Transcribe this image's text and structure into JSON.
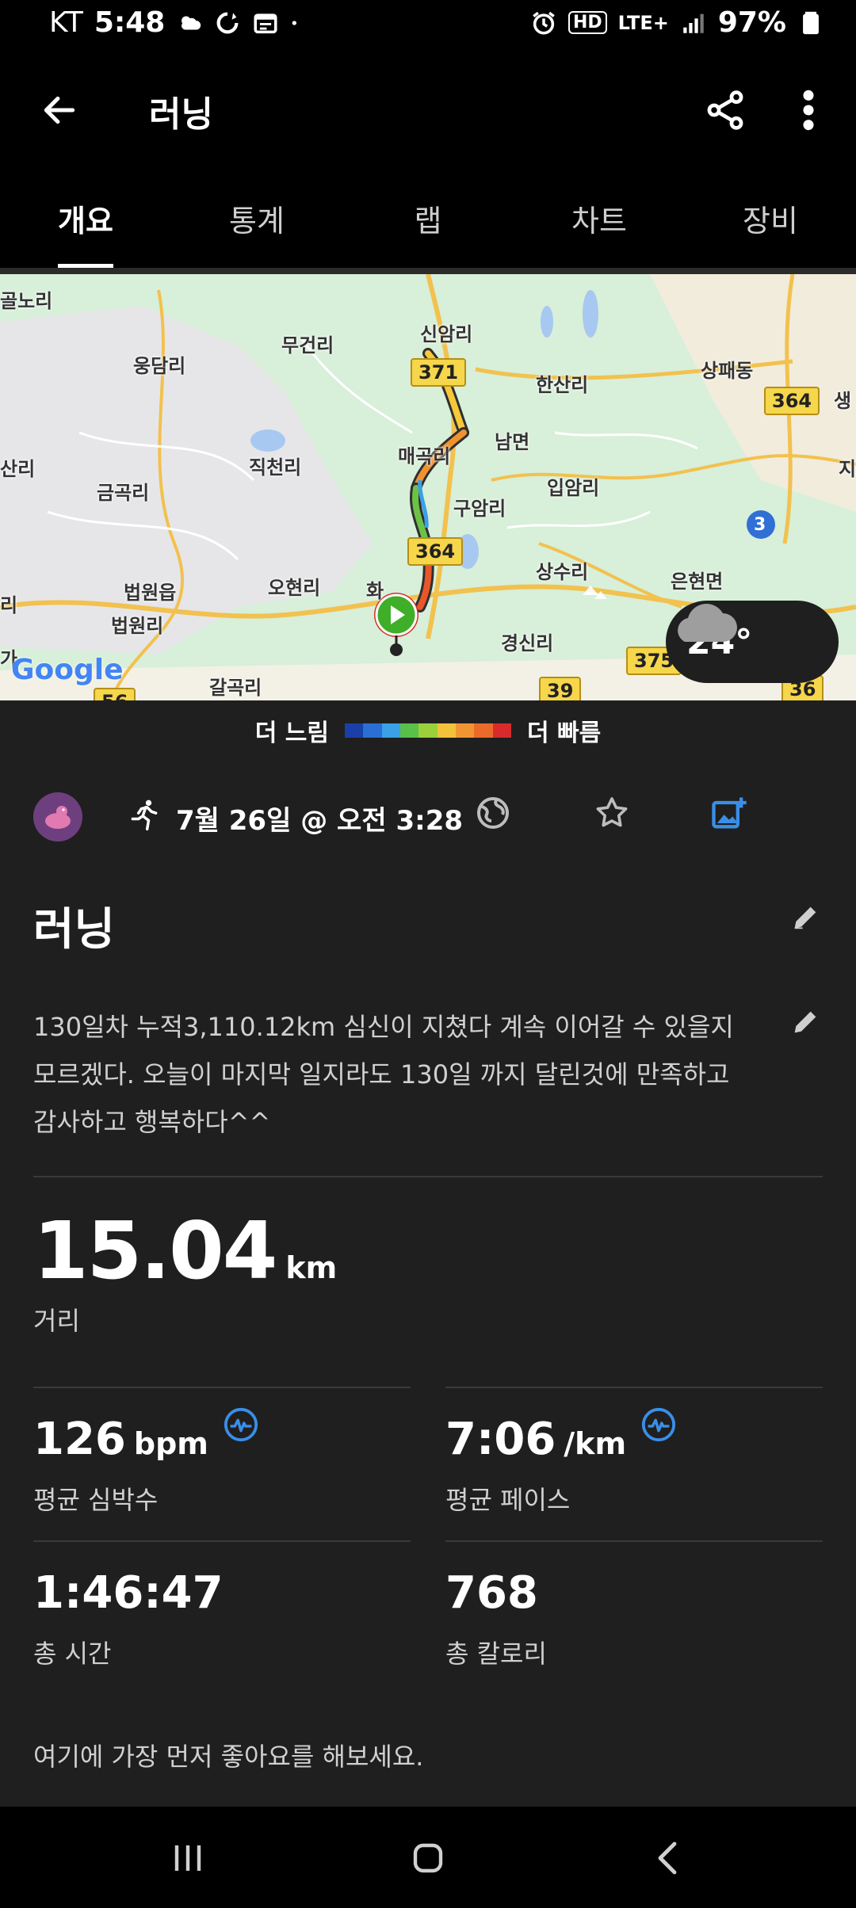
{
  "status_bar": {
    "carrier": "KT",
    "time": "5:48",
    "network": "LTE+",
    "hd": "HD",
    "battery": "97%"
  },
  "header": {
    "title": "러닝"
  },
  "tabs": [
    {
      "label": "개요",
      "active": true
    },
    {
      "label": "통계",
      "active": false
    },
    {
      "label": "랩",
      "active": false
    },
    {
      "label": "차트",
      "active": false
    },
    {
      "label": "장비",
      "active": false
    }
  ],
  "map": {
    "labels": [
      "신암리",
      "무건리",
      "웅담리",
      "한산리",
      "상패동",
      "남면",
      "매곡리",
      "직천리",
      "금곡리",
      "입암리",
      "구암리",
      "상수리",
      "은현면",
      "오현리",
      "법원읍",
      "법원리",
      "경신리",
      "갈곡리",
      "화",
      "산리",
      "리",
      "가",
      "생",
      "지",
      "골노리"
    ],
    "road_numbers": [
      "371",
      "364",
      "364",
      "375",
      "39",
      "56",
      "3",
      "36"
    ],
    "logo": "Google",
    "weather_temp": "24°"
  },
  "legend": {
    "slow_label": "더 느림",
    "fast_label": "더 빠름",
    "colors": [
      "#1a3fa8",
      "#2a6fd6",
      "#3aa0e8",
      "#59c04a",
      "#9bd03c",
      "#f2c23a",
      "#f19533",
      "#ea6a2a",
      "#d92b2b"
    ]
  },
  "activity": {
    "date_time": "7월 26일 @ 오전 3:28",
    "title": "러닝",
    "note": "130일차 누적3,110.12km 심신이 지쳤다 계속 이어갈 수 있을지 모르겠다. 오늘이 마지막 일지라도 130일 까지 달린것에 만족하고 감사하고 행복하다^^",
    "distance_value": "15.04",
    "distance_unit": "km",
    "distance_label": "거리",
    "stats": {
      "hr_value": "126",
      "hr_unit": "bpm",
      "hr_label": "평균 심박수",
      "pace_value": "7:06",
      "pace_unit": "/km",
      "pace_label": "평균 페이스",
      "time_value": "1:46:47",
      "time_label": "총 시간",
      "cal_value": "768",
      "cal_label": "총 칼로리"
    },
    "like_prompt": "여기에 가장 먼저 좋아요를 해보세요."
  }
}
